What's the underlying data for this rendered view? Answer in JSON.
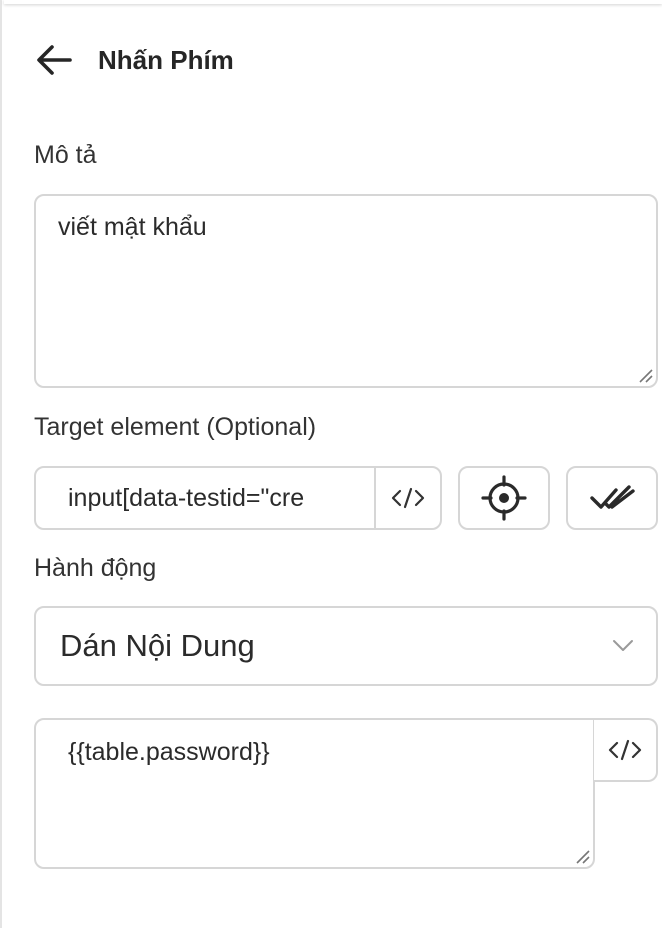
{
  "header": {
    "title": "Nhấn Phím",
    "back_icon": "arrow-left-icon"
  },
  "description": {
    "label": "Mô tả",
    "value": "viết mật khẩu"
  },
  "target": {
    "label": "Target element (Optional)",
    "value": "input[data-testid=\"cre",
    "code_icon": "code-icon",
    "pick_icon": "crosshair-icon",
    "check_icon": "double-check-icon"
  },
  "action": {
    "label": "Hành động",
    "selected": "Dán Nội Dung",
    "chevron_icon": "chevron-down-icon"
  },
  "content": {
    "value": "{{table.password}}",
    "code_icon": "code-icon"
  },
  "colors": {
    "border": "#d6d6d6",
    "text": "#2b2b2b"
  }
}
